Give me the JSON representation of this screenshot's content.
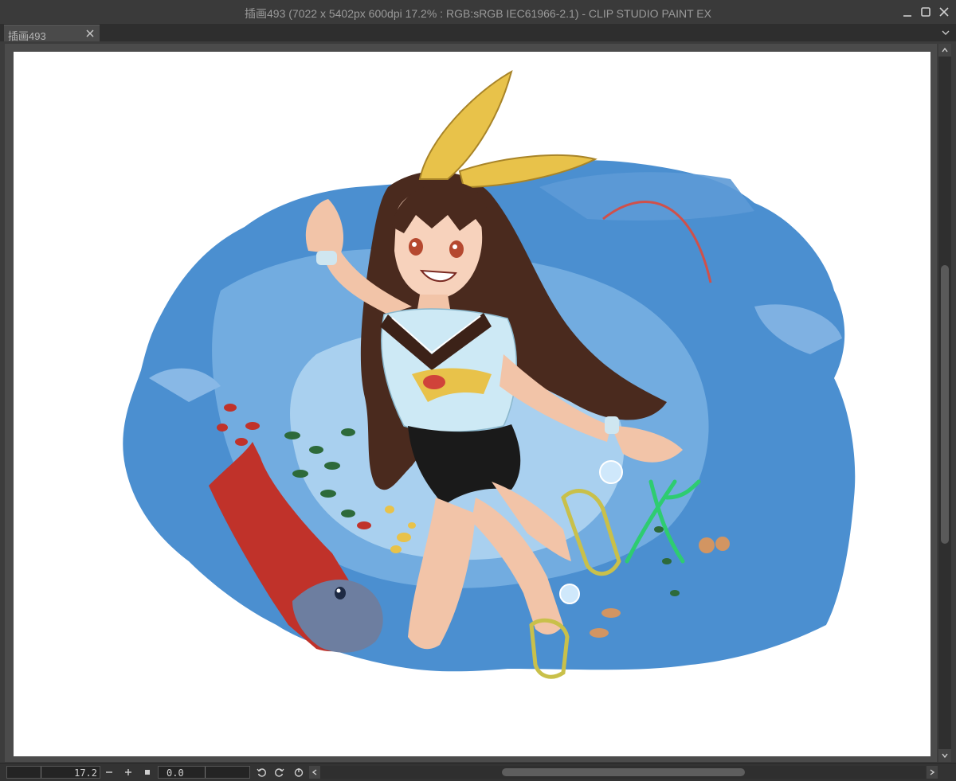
{
  "window": {
    "title": "插画493 (7022 x 5402px 600dpi 17.2% : RGB:sRGB IEC61966-2.1)  - CLIP STUDIO PAINT EX"
  },
  "tabs": [
    {
      "label": "插画493",
      "active": true
    }
  ],
  "statusbar": {
    "zoom_value": "17.2",
    "rotation_value": "0.0"
  },
  "colors": {
    "chrome_bg": "#3c3c3c",
    "paper": "#ffffff",
    "water_blue": "#4b8fd0",
    "fish_red": "#c0322a",
    "hair_brown": "#4a2a1e",
    "ribbon_yellow": "#e8c24a"
  },
  "icons": {
    "minimize": "minimize-icon",
    "maximize": "maximize-icon",
    "close": "close-icon",
    "tab_close": "close-icon",
    "tab_menu": "chevron-down-icon",
    "zoom_out": "minus-icon",
    "zoom_in": "plus-icon",
    "fit": "square-icon",
    "rotate_left": "rotate-left-icon",
    "rotate_right": "rotate-right-icon",
    "reset_rotation": "reset-rotation-icon"
  }
}
